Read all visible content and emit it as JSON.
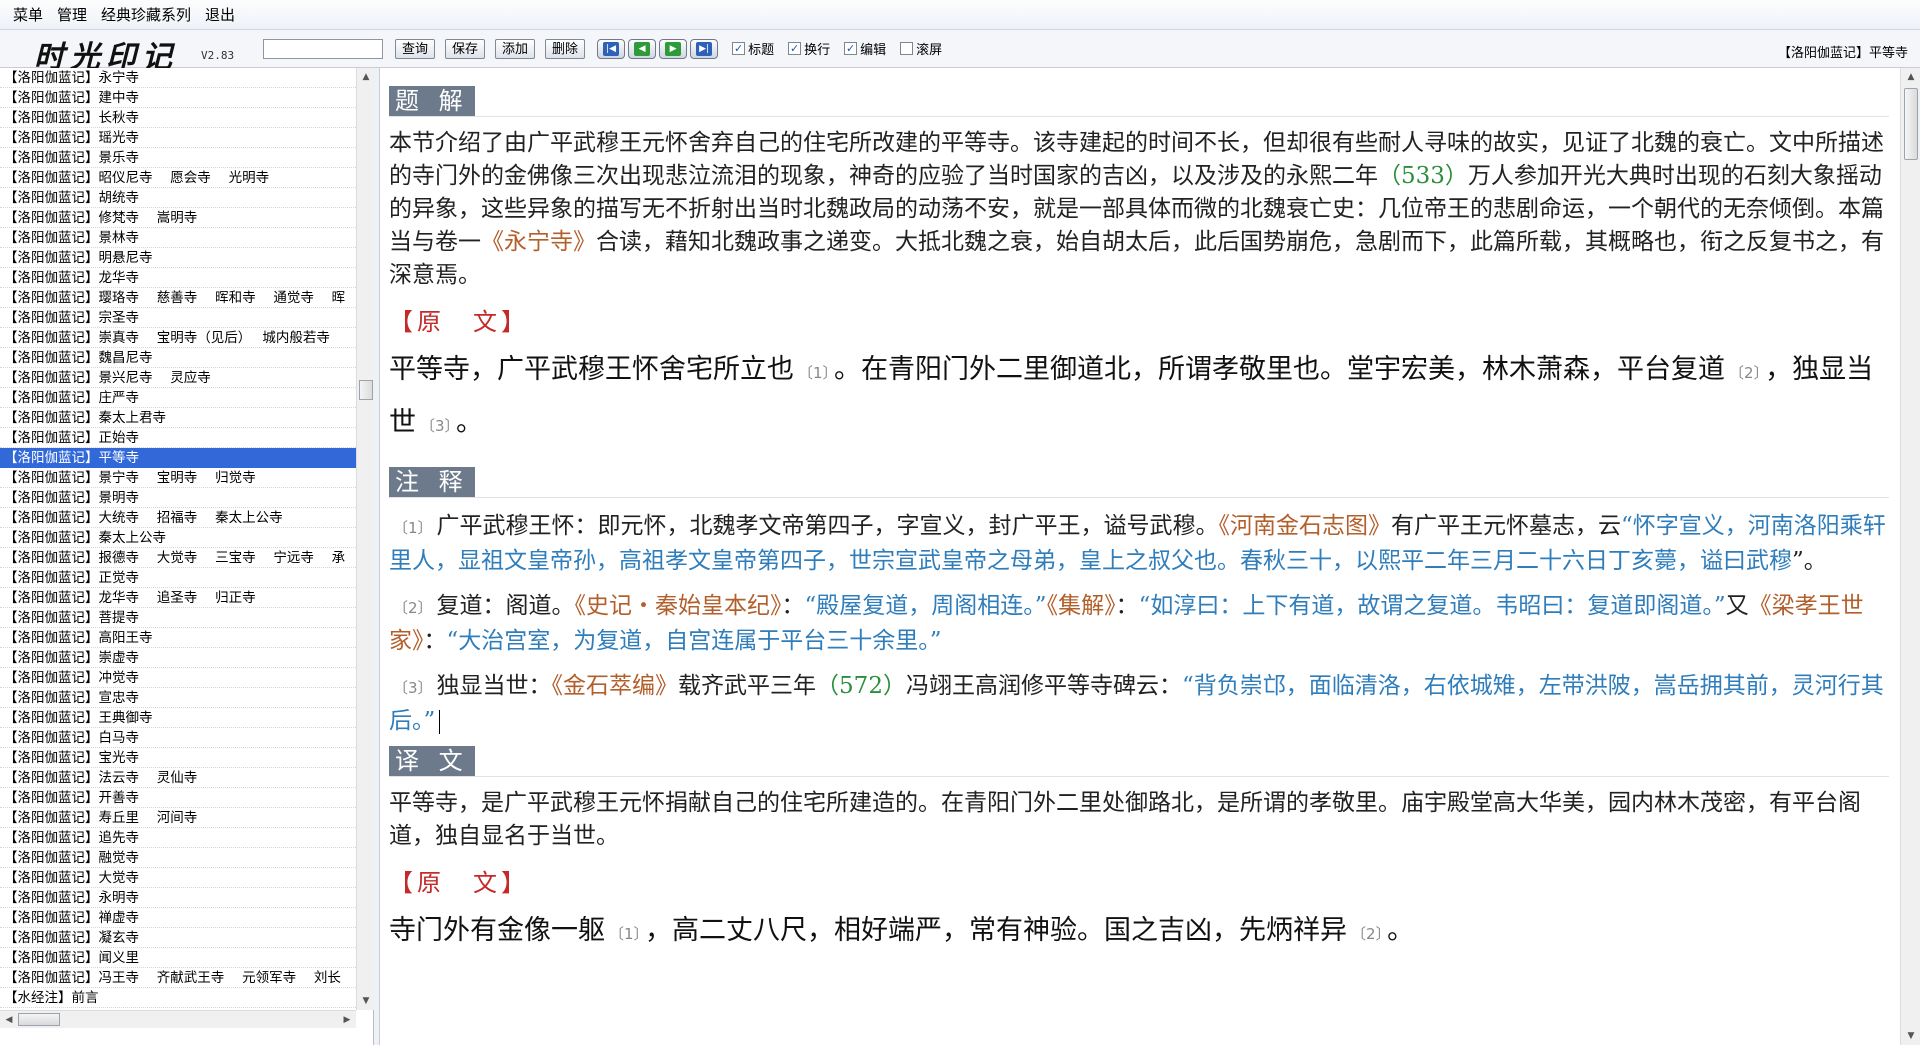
{
  "menu": [
    "菜单",
    "管理",
    "经典珍藏系列",
    "退出"
  ],
  "toolbar": {
    "logo_text": "时光印记",
    "version": "V2.83",
    "search_value": "",
    "query_label": "查询",
    "save_label": "保存",
    "add_label": "添加",
    "delete_label": "删除",
    "nav_icons": [
      "first-page-icon",
      "previous-page-icon",
      "next-page-icon",
      "last-page-icon"
    ],
    "checkboxes": [
      {
        "label": "标题",
        "checked": true
      },
      {
        "label": "换行",
        "checked": true
      },
      {
        "label": "编辑",
        "checked": true
      },
      {
        "label": "滚屏",
        "checked": false
      }
    ],
    "current_title": "【洛阳伽蓝记】平等寺"
  },
  "list": {
    "selected_index": 19,
    "items": [
      "【洛阳伽蓝记】永宁寺",
      "【洛阳伽蓝记】建中寺",
      "【洛阳伽蓝记】长秋寺",
      "【洛阳伽蓝记】瑶光寺",
      "【洛阳伽蓝记】景乐寺",
      "【洛阳伽蓝记】昭仪尼寺　 愿会寺　 光明寺",
      "【洛阳伽蓝记】胡统寺",
      "【洛阳伽蓝记】修梵寺　 嵩明寺",
      "【洛阳伽蓝记】景林寺",
      "【洛阳伽蓝记】明悬尼寺",
      "【洛阳伽蓝记】龙华寺",
      "【洛阳伽蓝记】璎珞寺　 慈善寺　 晖和寺　 通觉寺　 晖",
      "【洛阳伽蓝记】宗圣寺",
      "【洛阳伽蓝记】崇真寺　 宝明寺（见后）　 城内般若寺",
      "【洛阳伽蓝记】魏昌尼寺",
      "【洛阳伽蓝记】景兴尼寺　 灵应寺",
      "【洛阳伽蓝记】庄严寺",
      "【洛阳伽蓝记】秦太上君寺",
      "【洛阳伽蓝记】正始寺",
      "【洛阳伽蓝记】平等寺",
      "【洛阳伽蓝记】景宁寺　 宝明寺　 归觉寺",
      "【洛阳伽蓝记】景明寺",
      "【洛阳伽蓝记】大统寺　 招福寺　 秦太上公寺",
      "【洛阳伽蓝记】秦太上公寺",
      "【洛阳伽蓝记】报德寺　 大觉寺　 三宝寺　 宁远寺　 承",
      "【洛阳伽蓝记】正觉寺",
      "【洛阳伽蓝记】龙华寺　 追圣寺　 归正寺",
      "【洛阳伽蓝记】菩提寺",
      "【洛阳伽蓝记】高阳王寺",
      "【洛阳伽蓝记】崇虚寺",
      "【洛阳伽蓝记】冲觉寺",
      "【洛阳伽蓝记】宣忠寺",
      "【洛阳伽蓝记】王典御寺",
      "【洛阳伽蓝记】白马寺",
      "【洛阳伽蓝记】宝光寺",
      "【洛阳伽蓝记】法云寺　 灵仙寺",
      "【洛阳伽蓝记】开善寺",
      "【洛阳伽蓝记】寿丘里　 河间寺",
      "【洛阳伽蓝记】追先寺",
      "【洛阳伽蓝记】融觉寺",
      "【洛阳伽蓝记】大觉寺",
      "【洛阳伽蓝记】永明寺",
      "【洛阳伽蓝记】禅虚寺",
      "【洛阳伽蓝记】凝玄寺",
      "【洛阳伽蓝记】闻义里",
      "【洛阳伽蓝记】冯王寺　 齐献武王寺　 元领军寺　 刘长",
      "【水经注】前言"
    ]
  },
  "content": {
    "tijie_label": "题 解",
    "tijie_text": [
      {
        "t": "本节介绍了由广平武穆王元怀舍弃自己的住宅所改建的平等寺。该寺建起的时间不长，但却很有些耐人寻味的故实，见证了北魏的衰亡。文中所描述的寺门外的金佛像三次出现悲泣流泪的现象，神奇的应验了当时国家的吉凶，以及涉及的永熙二年"
      },
      {
        "t": "（533）",
        "c": "num"
      },
      {
        "t": "万人参加开光大典时出现的石刻大象摇动的异象，这些异象的描写无不折射出当时北魏政局的动荡不安，就是一部具体而微的北魏衰亡史：几位帝王的悲剧命运，一个朝代的无奈倾倒。本篇当与卷一"
      },
      {
        "t": "《永宁寺》",
        "c": "book"
      },
      {
        "t": "合读，藉知北魏政事之递变。大抵北魏之衰，始自胡太后，此后国势崩危，急剧而下，此篇所载，其概略也，衔之反复书之，有深意焉。"
      }
    ],
    "yuanwen_head": "【原　文】",
    "yuanwen1": [
      {
        "t": "平等寺，广平武穆王怀舍宅所立也"
      },
      {
        "t": "〔1〕",
        "c": "mark"
      },
      {
        "t": "。在青阳门外二里御道北，所谓孝敬里也。堂宇宏美，林木萧森，平台复道"
      },
      {
        "t": "〔2〕",
        "c": "mark"
      },
      {
        "t": "，独显当世"
      },
      {
        "t": "〔3〕",
        "c": "mark"
      },
      {
        "t": "。"
      }
    ],
    "zhushi_label": "注 释",
    "notes": [
      [
        {
          "t": "〔1〕",
          "c": "mark"
        },
        {
          "t": "广平武穆王怀：即元怀，北魏孝文帝第四子，字宣义，封广平王，谥号武穆。"
        },
        {
          "t": "《河南金石志图》",
          "c": "book"
        },
        {
          "t": "有广平王元怀墓志，云"
        },
        {
          "t": "“怀字宣义，河南洛阳乘轩里人，显祖文皇帝孙，高祖孝文皇帝第四子，世宗宣武皇帝之母弟，皇上之叔父也。春秋三十，以熙平二年三月二十六日丁亥薨，谥曰武穆",
          "c": "quote"
        },
        {
          "t": "”。"
        }
      ],
      [
        {
          "t": "〔2〕",
          "c": "mark"
        },
        {
          "t": "复道：阁道。"
        },
        {
          "t": "《史记・秦始皇本纪》",
          "c": "book"
        },
        {
          "t": "："
        },
        {
          "t": "“殿屋复道，周阁相连。”",
          "c": "quote"
        },
        {
          "t": "《集解》",
          "c": "book"
        },
        {
          "t": "："
        },
        {
          "t": "“如淳曰：上下有道，故谓之复道。韦昭曰：复道即阁道。”",
          "c": "quote"
        },
        {
          "t": "又"
        },
        {
          "t": "《梁孝王世家》",
          "c": "book"
        },
        {
          "t": "："
        },
        {
          "t": "“大治宫室，为复道，自宫连属于平台三十余里。”",
          "c": "quote"
        }
      ],
      [
        {
          "t": "〔3〕",
          "c": "mark"
        },
        {
          "t": "独显当世："
        },
        {
          "t": "《金石萃编》",
          "c": "book"
        },
        {
          "t": "载齐武平三年"
        },
        {
          "t": "（572）",
          "c": "num"
        },
        {
          "t": "冯翊王高润修平等寺碑云："
        },
        {
          "t": "“背负崇邙，面临清洛，右依城雉，左带洪陂，嵩岳拥其前，灵河行其后。”",
          "c": "quote"
        }
      ]
    ],
    "yiwen_label": "译 文",
    "yiwen_text": "平等寺，是广平武穆王元怀捐献自己的住宅所建造的。在青阳门外二里处御路北，是所谓的孝敬里。庙宇殿堂高大华美，园内林木茂密，有平台阁道，独自显名于当世。",
    "yuanwen2": [
      {
        "t": "寺门外有金像一躯"
      },
      {
        "t": "〔1〕",
        "c": "mark"
      },
      {
        "t": "，高二丈八尺，相好端严，常有神验。国之吉凶，先炳祥异"
      },
      {
        "t": "〔2〕",
        "c": "mark"
      },
      {
        "t": "。"
      }
    ]
  }
}
